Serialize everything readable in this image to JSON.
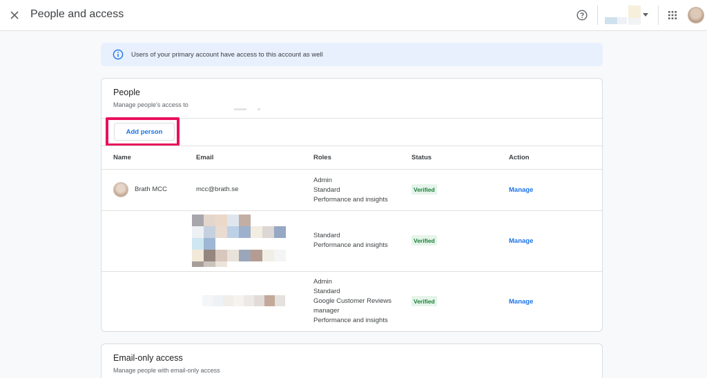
{
  "topbar": {
    "title": "People and access",
    "close_icon": "close-icon",
    "help_icon": "help-icon",
    "apps_icon": "apps-grid-icon"
  },
  "banner": {
    "icon": "info-icon",
    "text": "Users of your primary account have access to this account as well"
  },
  "people": {
    "title": "People",
    "subtitle": "Manage people's access to",
    "add_button": "Add person",
    "columns": [
      "Name",
      "Email",
      "Roles",
      "Status",
      "Action"
    ],
    "rows": [
      {
        "name": "Brath MCC",
        "email": "mcc@brath.se",
        "roles": [
          "Admin",
          "Standard",
          "Performance and insights"
        ],
        "status": "Verified",
        "action": "Manage"
      },
      {
        "name": "",
        "email": "",
        "roles": [
          "Standard",
          "Performance and insights"
        ],
        "status": "Verified",
        "action": "Manage"
      },
      {
        "name": "",
        "email": "",
        "roles": [
          "Admin",
          "Standard",
          "Google Customer Reviews",
          "manager",
          "Performance and insights"
        ],
        "status": "Verified",
        "action": "Manage"
      }
    ]
  },
  "email_only": {
    "title": "Email-only access",
    "subtitle": "Manage people with email-only access"
  },
  "colors": {
    "accent": "#1a73e8",
    "highlight": "#e8115b",
    "verified_bg": "#e6f4ea",
    "verified_text": "#188038",
    "banner_bg": "#e8f0fe"
  }
}
